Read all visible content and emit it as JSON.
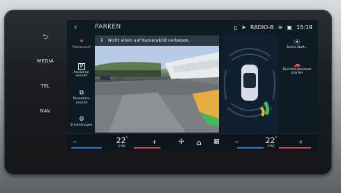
{
  "left_nav": {
    "back_icon": "back-arrow-icon",
    "items": [
      "MEDIA",
      "TEL",
      "NAV"
    ]
  },
  "header": {
    "title": "PARKEN",
    "status": {
      "radio": "RADIO-B",
      "time": "15:19"
    }
  },
  "sidebar": {
    "items": [
      {
        "icon": "parking-sensor-icon",
        "label": "Parkansicht",
        "active": true
      },
      {
        "icon": "parking-assist-icon",
        "label": "Assistenz-\nansicht",
        "active": false
      },
      {
        "icon": "panorama-car-icon",
        "label": "Panorama-\nansicht",
        "active": false
      },
      {
        "icon": "settings-gear-icon",
        "label": "Einstellungen",
        "active": false
      }
    ]
  },
  "camera": {
    "warning": "Nicht allein auf Kamerabild verlassen."
  },
  "right_panel": {
    "items": [
      {
        "icon": "parking-search-icon",
        "label": "Suche läuft..."
      },
      {
        "icon": "car-side-icon",
        "label": "Rückfahrassistent starten"
      }
    ]
  },
  "climate": {
    "left": {
      "temp": "22",
      "unit": "°",
      "sync_label": "SYNC"
    },
    "right": {
      "temp": "22",
      "unit": "°",
      "sync_label": "SYNC"
    }
  },
  "dock": {
    "items": [
      "fan-icon",
      "home-icon",
      "apps-grid-icon"
    ]
  },
  "colors": {
    "accent": "#ff9a7a",
    "blue": "#2f78d8",
    "red": "#d4474f",
    "sensor_green": "#3fbf58",
    "sensor_yellow": "#e2b53a"
  }
}
